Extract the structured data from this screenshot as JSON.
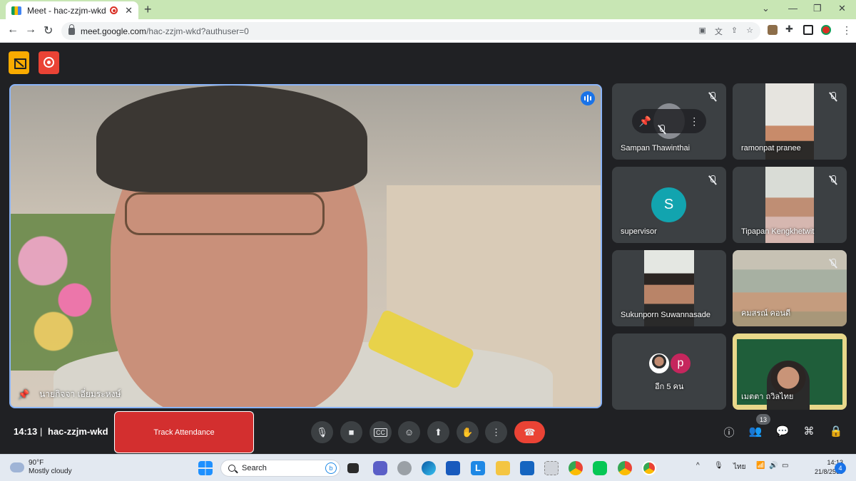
{
  "browser": {
    "tab_title": "Meet - hac-zzjm-wkd",
    "tab_close": "✕",
    "new_tab": "+",
    "url_host": "meet.google.com",
    "url_path": "/hac-zzjm-wkd?authuser=0",
    "window_controls": {
      "minimize": "—",
      "maximize": "❐",
      "close": "✕"
    },
    "menu_kebab": "⋮",
    "nav": {
      "back": "←",
      "forward": "→",
      "reload": "↻"
    },
    "chrome_accent": "#c8e6b4"
  },
  "meet": {
    "main_speaker": {
      "name": "นายกิจจา เอี่ยมระหงษ์",
      "pin_icon": "pin-icon"
    },
    "participants": [
      {
        "name": "Sampan Thawinthai",
        "muted": true
      },
      {
        "name": "ramonpat pranee",
        "muted": true
      },
      {
        "name": "supervisor",
        "muted": true,
        "avatar_letter": "S"
      },
      {
        "name": "Tipapan Kengkhetwit",
        "muted": true
      },
      {
        "name": "Sukunporn Suwannasade",
        "muted": false
      },
      {
        "name": "คมสรณ์ คอนดี",
        "muted": true
      },
      {
        "name": "อีก 5 คน",
        "avatar_letter": "p"
      },
      {
        "name": "เมตตา ถวิลไทย",
        "muted": false
      }
    ],
    "hover_controls": {
      "pin": "📌",
      "more": "⋮"
    },
    "bottom": {
      "time": "14:13",
      "separator": "|",
      "meeting_code": "hac-zzjm-wkd",
      "track_attendance": "Track Attendance",
      "people_count": "13"
    },
    "colors": {
      "speaking_border": "#8ab4f8",
      "hangup": "#ea4335",
      "supervisor_avatar": "#12a4af",
      "p_avatar": "#c5265d"
    }
  },
  "taskbar": {
    "weather_temp": "90°F",
    "weather_desc": "Mostly cloudy",
    "search_label": "Search",
    "language": "ไทย",
    "clock_time": "14:13",
    "clock_date": "21/8/2566",
    "notification_count": "4",
    "tray_chevron": "^"
  }
}
